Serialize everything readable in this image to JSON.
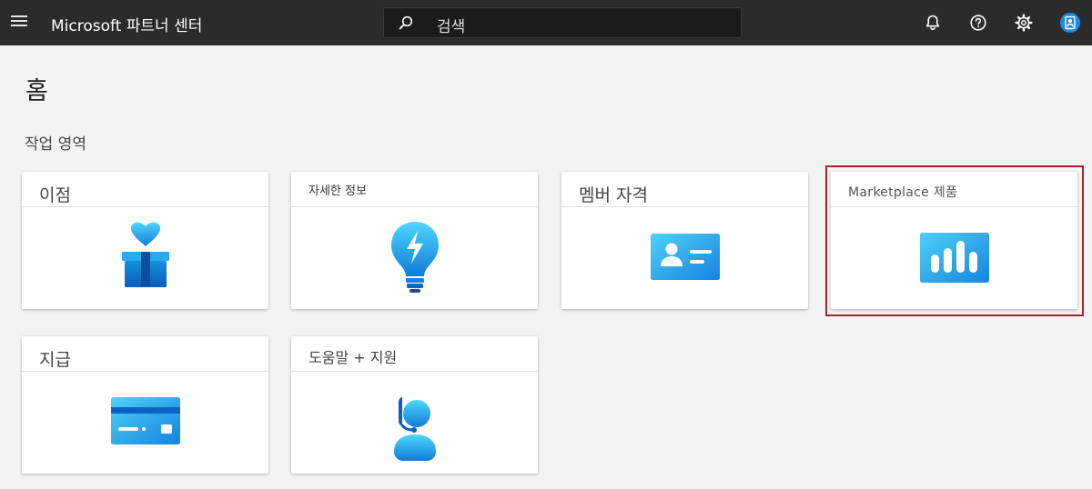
{
  "header": {
    "app_title": "Microsoft 파트너 센터",
    "search_text": "검색",
    "icons": [
      "menu-icon",
      "search-icon",
      "bell-icon",
      "help-icon",
      "gear-icon",
      "avatar-icon"
    ]
  },
  "page": {
    "title": "홈",
    "section_title": "작업 영역"
  },
  "tiles": [
    {
      "label": "이점",
      "icon": "gift-heart-icon"
    },
    {
      "label": "자세한 정보",
      "icon": "lightbulb-icon"
    },
    {
      "label": "멤버 자격",
      "icon": "id-card-icon"
    },
    {
      "label": "Marketplace 제품",
      "icon": "bar-chart-icon"
    },
    {
      "label": "지급",
      "icon": "credit-card-icon"
    },
    {
      "label": "도움말 + 지원",
      "icon": "headset-person-icon"
    }
  ],
  "colors": {
    "topbar": "#2b2b2b",
    "accent_light": "#50e6ff",
    "accent_dark": "#0078d4",
    "highlight": "#a4262c"
  }
}
